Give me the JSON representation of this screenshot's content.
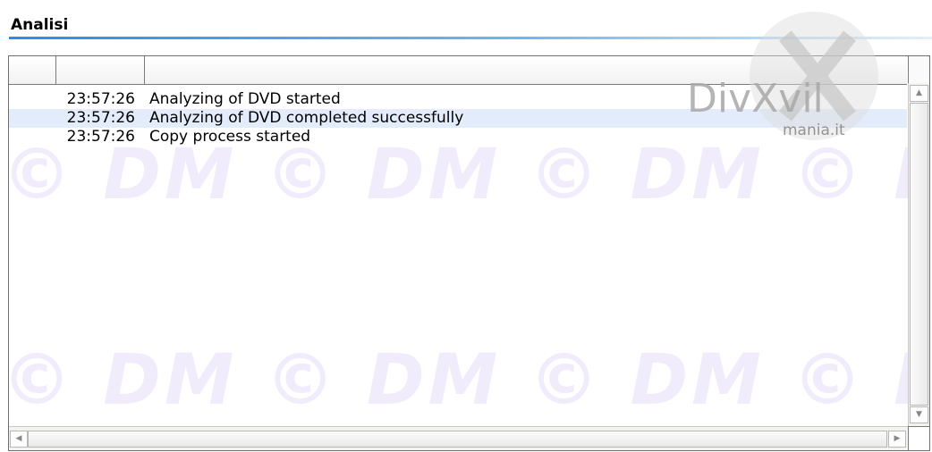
{
  "panel": {
    "title": "Analisi"
  },
  "log": {
    "rows": [
      {
        "time": "23:57:26",
        "message": "Analyzing of DVD started"
      },
      {
        "time": "23:57:26",
        "message": "Analyzing of DVD completed successfully"
      },
      {
        "time": "23:57:26",
        "message": "Copy process started"
      }
    ]
  },
  "watermark": {
    "line1": "© DM © DM © DM © DM ©",
    "line2": "© DM © DM © DM © DM ©",
    "logo_text": "DivXvil",
    "logo_subtext": "mania.it"
  },
  "scrollbars": {
    "up_arrow": "▲",
    "down_arrow": "▼",
    "left_arrow": "◀",
    "right_arrow": "▶"
  },
  "colors": {
    "accent": "#2a8ee6",
    "selection": "#d0e0f6"
  }
}
